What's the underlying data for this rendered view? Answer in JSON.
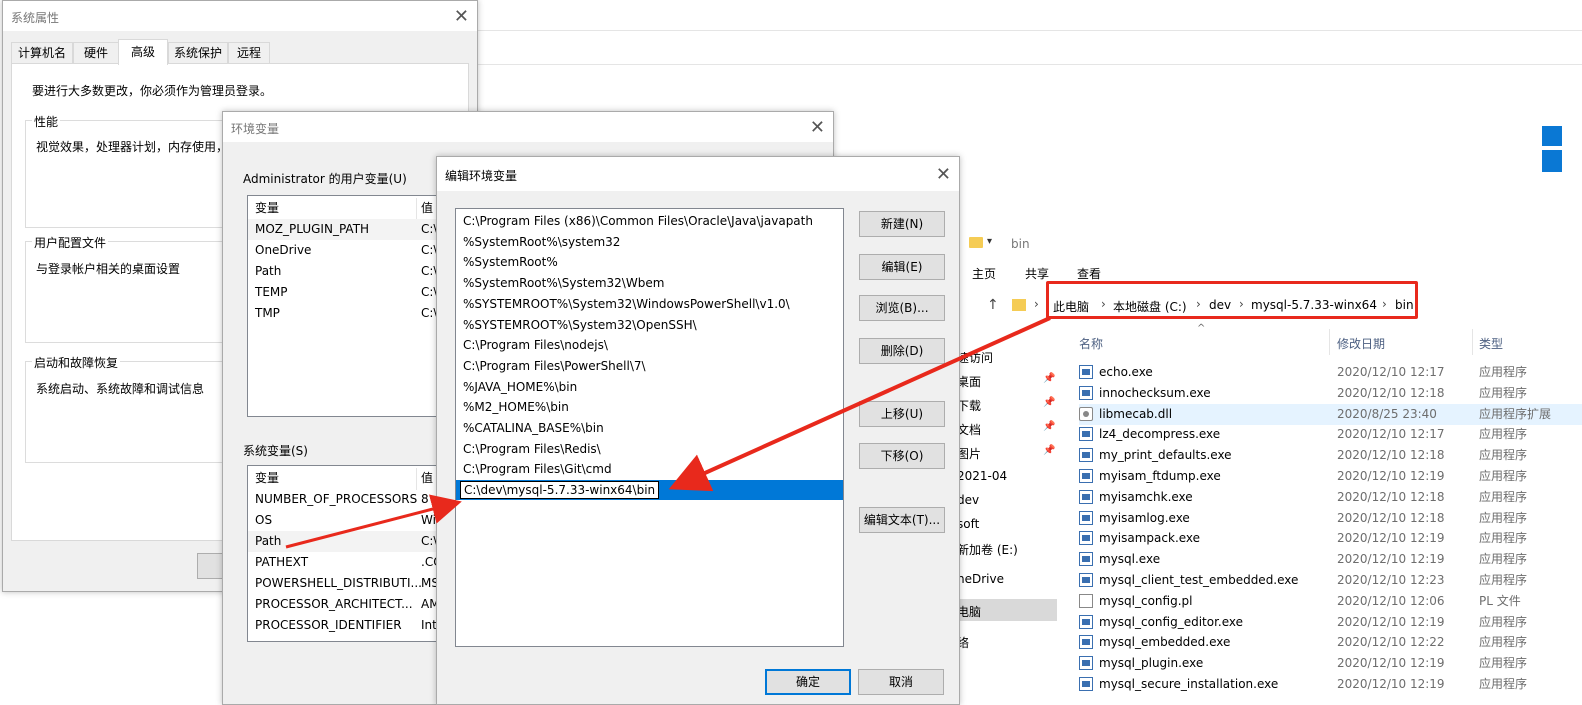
{
  "sys_props": {
    "title": "系统属性",
    "tabs": [
      "计算机名",
      "硬件",
      "高级",
      "系统保护",
      "远程"
    ],
    "active_tab": "高级",
    "admin_note": "要进行大多数更改，你必须作为管理员登录。",
    "perf_label": "性能",
    "perf_desc": "视觉效果，处理器计划，内存使用，",
    "profile_label": "用户配置文件",
    "profile_desc": "与登录帐户相关的桌面设置",
    "startup_label": "启动和故障恢复",
    "startup_desc": "系统启动、系统故障和调试信息"
  },
  "env_vars": {
    "title": "环境变量",
    "user_section": "Administrator 的用户变量(U)",
    "col_var": "变量",
    "col_val": "值",
    "user_rows": [
      {
        "name": "MOZ_PLUGIN_PATH",
        "value": "C:\\"
      },
      {
        "name": "OneDrive",
        "value": "C:\\"
      },
      {
        "name": "Path",
        "value": "C:\\"
      },
      {
        "name": "TEMP",
        "value": "C:\\"
      },
      {
        "name": "TMP",
        "value": "C:\\"
      }
    ],
    "sys_section": "系统变量(S)",
    "sys_rows": [
      {
        "name": "NUMBER_OF_PROCESSORS",
        "value": "8"
      },
      {
        "name": "OS",
        "value": "Wi"
      },
      {
        "name": "Path",
        "value": "C:\\"
      },
      {
        "name": "PATHEXT",
        "value": ".CO"
      },
      {
        "name": "POWERSHELL_DISTRIBUTI...",
        "value": "MS"
      },
      {
        "name": "PROCESSOR_ARCHITECT...",
        "value": "AM"
      },
      {
        "name": "PROCESSOR_IDENTIFIER",
        "value": "Int"
      }
    ]
  },
  "edit_env": {
    "title": "编辑环境变量",
    "entries": [
      "C:\\Program Files (x86)\\Common Files\\Oracle\\Java\\javapath",
      "%SystemRoot%\\system32",
      "%SystemRoot%",
      "%SystemRoot%\\System32\\Wbem",
      "%SYSTEMROOT%\\System32\\WindowsPowerShell\\v1.0\\",
      "%SYSTEMROOT%\\System32\\OpenSSH\\",
      "C:\\Program Files\\nodejs\\",
      "C:\\Program Files\\PowerShell\\7\\",
      "%JAVA_HOME%\\bin",
      "%M2_HOME%\\bin",
      "%CATALINA_BASE%\\bin",
      "C:\\Program Files\\Redis\\",
      "C:\\Program Files\\Git\\cmd"
    ],
    "editing_value": "C:\\dev\\mysql-5.7.33-winx64\\bin",
    "buttons": {
      "new": "新建(N)",
      "edit": "编辑(E)",
      "browse": "浏览(B)...",
      "delete": "删除(D)",
      "up": "上移(U)",
      "down": "下移(O)",
      "edit_text": "编辑文本(T)...",
      "ok": "确定",
      "cancel": "取消"
    }
  },
  "explorer": {
    "title": "bin",
    "ribbon_tabs": [
      "主页",
      "共享",
      "查看"
    ],
    "breadcrumb": [
      "此电脑",
      "本地磁盘 (C:)",
      "dev",
      "mysql-5.7.33-winx64",
      "bin"
    ],
    "nav_items": [
      "速访问",
      "桌面",
      "下载",
      "文档",
      "图片",
      "2021-04",
      "dev",
      "soft",
      "新加卷 (E:)",
      "neDrive",
      "电脑",
      "络"
    ],
    "col_name": "名称",
    "col_date": "修改日期",
    "col_type": "类型",
    "files": [
      {
        "name": "echo.exe",
        "date": "2020/12/10 12:17",
        "type": "应用程序",
        "icon": "exe"
      },
      {
        "name": "innochecksum.exe",
        "date": "2020/12/10 12:18",
        "type": "应用程序",
        "icon": "exe"
      },
      {
        "name": "libmecab.dll",
        "date": "2020/8/25 23:40",
        "type": "应用程序扩展",
        "icon": "dll"
      },
      {
        "name": "lz4_decompress.exe",
        "date": "2020/12/10 12:17",
        "type": "应用程序",
        "icon": "exe"
      },
      {
        "name": "my_print_defaults.exe",
        "date": "2020/12/10 12:18",
        "type": "应用程序",
        "icon": "exe"
      },
      {
        "name": "myisam_ftdump.exe",
        "date": "2020/12/10 12:19",
        "type": "应用程序",
        "icon": "exe"
      },
      {
        "name": "myisamchk.exe",
        "date": "2020/12/10 12:18",
        "type": "应用程序",
        "icon": "exe"
      },
      {
        "name": "myisamlog.exe",
        "date": "2020/12/10 12:18",
        "type": "应用程序",
        "icon": "exe"
      },
      {
        "name": "myisampack.exe",
        "date": "2020/12/10 12:19",
        "type": "应用程序",
        "icon": "exe"
      },
      {
        "name": "mysql.exe",
        "date": "2020/12/10 12:19",
        "type": "应用程序",
        "icon": "exe"
      },
      {
        "name": "mysql_client_test_embedded.exe",
        "date": "2020/12/10 12:23",
        "type": "应用程序",
        "icon": "exe"
      },
      {
        "name": "mysql_config.pl",
        "date": "2020/12/10 12:06",
        "type": "PL 文件",
        "icon": "doc"
      },
      {
        "name": "mysql_config_editor.exe",
        "date": "2020/12/10 12:19",
        "type": "应用程序",
        "icon": "exe"
      },
      {
        "name": "mysql_embedded.exe",
        "date": "2020/12/10 12:22",
        "type": "应用程序",
        "icon": "exe"
      },
      {
        "name": "mysql_plugin.exe",
        "date": "2020/12/10 12:19",
        "type": "应用程序",
        "icon": "exe"
      },
      {
        "name": "mysql_secure_installation.exe",
        "date": "2020/12/10 12:19",
        "type": "应用程序",
        "icon": "exe"
      }
    ]
  },
  "colors": {
    "selection": "#0078d7",
    "annotation": "#e8291c",
    "win_logo": "#0a78d4"
  }
}
